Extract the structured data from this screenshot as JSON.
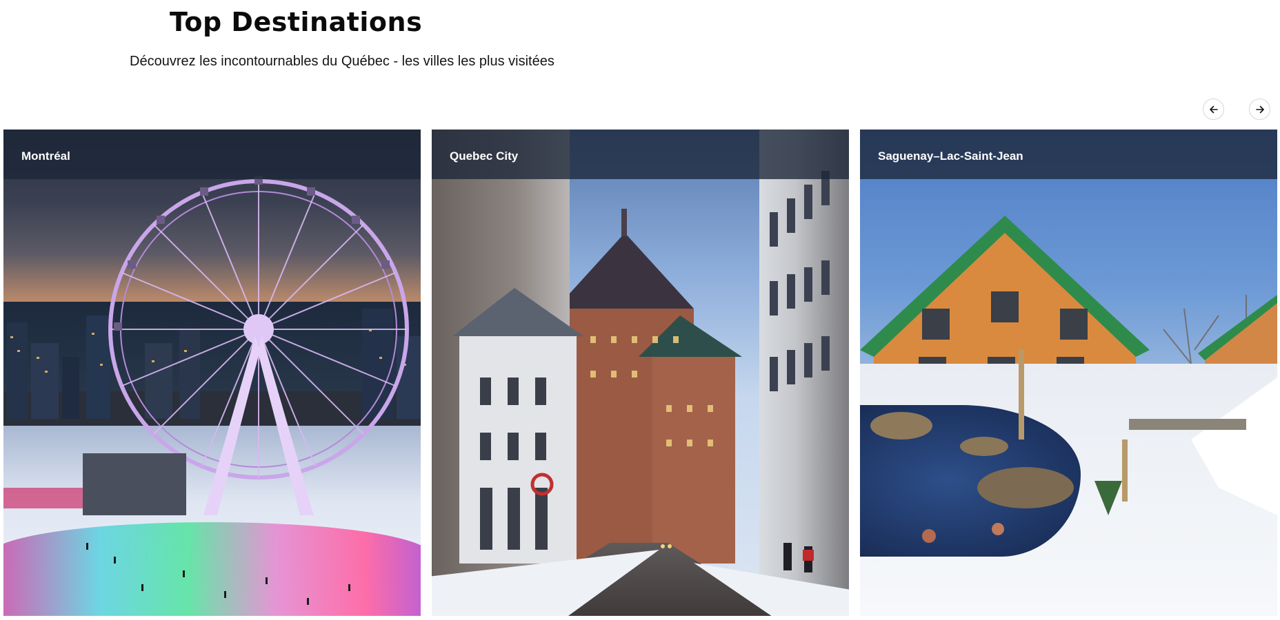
{
  "header": {
    "title": "Top Destinations",
    "subtitle": "Découvrez les incontournables du Québec - les villes les plus visitées"
  },
  "carousel": {
    "prev_icon": "arrow-left-icon",
    "next_icon": "arrow-right-icon"
  },
  "destinations": [
    {
      "name": "Montréal",
      "image": "montreal-ferris-wheel-photo"
    },
    {
      "name": "Quebec City",
      "image": "quebec-city-chateau-frontenac-photo"
    },
    {
      "name": "Saguenay–Lac-Saint-Jean",
      "image": "saguenay-chalet-spa-photo"
    }
  ],
  "colors": {
    "label_bar": "#1c2638",
    "title_text": "#0b0b0b",
    "background": "#ffffff"
  }
}
